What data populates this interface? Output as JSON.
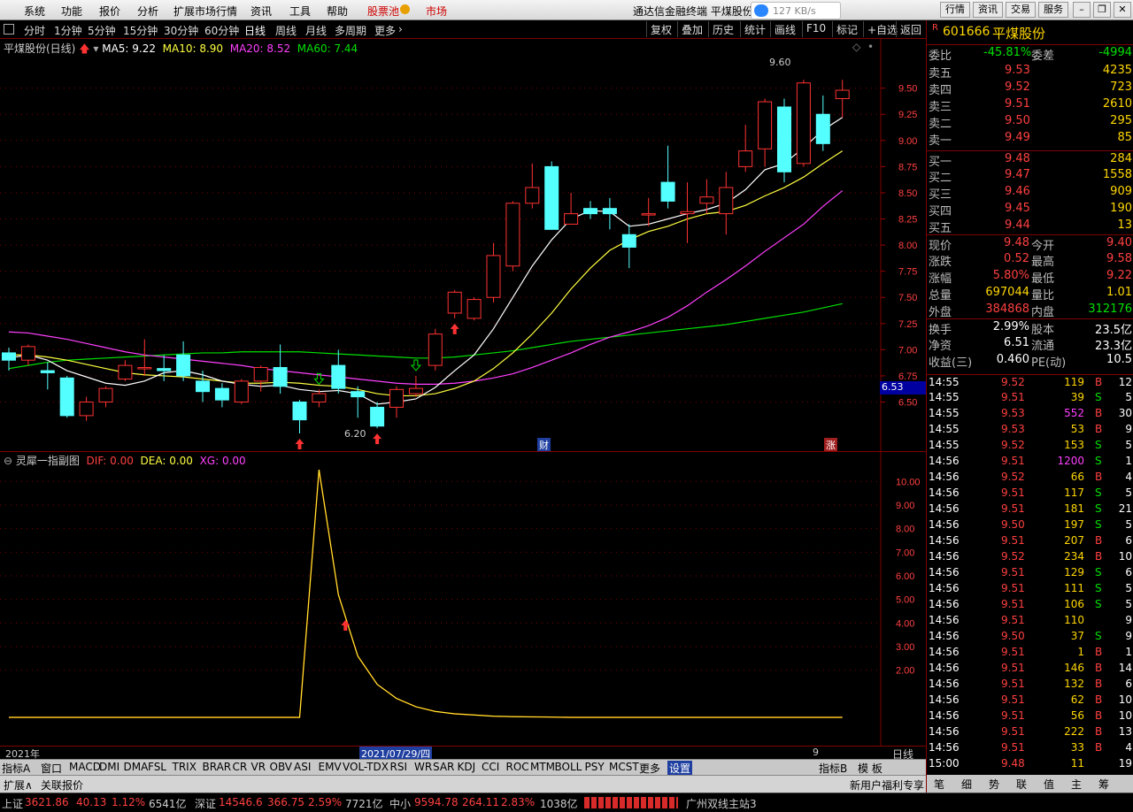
{
  "menu": {
    "items": [
      "系统",
      "功能",
      "报价",
      "分析",
      "扩展市场行情",
      "资讯",
      "工具",
      "帮助"
    ],
    "pool": "股票池",
    "market": "市场",
    "app_title": "通达信金融终端  平煤股份",
    "net_speed": "127 KB/s",
    "right_buttons": [
      "行情",
      "资讯",
      "交易",
      "服务"
    ]
  },
  "toolbar": {
    "periods": [
      "分时",
      "1分钟",
      "5分钟",
      "15分钟",
      "30分钟",
      "60分钟",
      "日线",
      "周线",
      "月线",
      "多周期",
      "更多"
    ],
    "active_period": "日线",
    "actions": [
      "复权",
      "叠加",
      "历史",
      "统计",
      "画线",
      "F10",
      "标记",
      "+自选",
      "返回"
    ]
  },
  "kline": {
    "stock_label": "平煤股份(日线)",
    "ma5": "MA5: 9.22",
    "ma10": "MA10: 8.90",
    "ma20": "MA20: 8.52",
    "ma60": "MA60: 7.44",
    "yaxis": [
      "9.50",
      "9.25",
      "9.00",
      "8.75",
      "8.50",
      "8.25",
      "8.00",
      "7.75",
      "7.50",
      "7.25",
      "7.00",
      "6.75",
      "6.50"
    ],
    "current_price_tag": "6.53",
    "high_label": "9.60",
    "low_label": "6.20",
    "marker_cai": "财",
    "marker_zhang": "涨",
    "colors": {
      "up": "#ff3232",
      "down": "#54ffff",
      "ma5": "#ffffff",
      "ma10": "#ffff40",
      "ma20": "#ff40ff",
      "ma60": "#00e000"
    }
  },
  "chart_data": {
    "type": "candlestick",
    "ylim": [
      6.2,
      9.7
    ],
    "candles": [
      {
        "o": 6.97,
        "c": 6.9,
        "h": 7.02,
        "l": 6.8
      },
      {
        "o": 6.9,
        "c": 7.03,
        "h": 7.05,
        "l": 6.85
      },
      {
        "o": 6.8,
        "c": 6.78,
        "h": 6.88,
        "l": 6.62
      },
      {
        "o": 6.73,
        "c": 6.37,
        "h": 6.75,
        "l": 6.35
      },
      {
        "o": 6.37,
        "c": 6.5,
        "h": 6.55,
        "l": 6.32
      },
      {
        "o": 6.5,
        "c": 6.63,
        "h": 6.65,
        "l": 6.45
      },
      {
        "o": 6.72,
        "c": 6.85,
        "h": 6.9,
        "l": 6.7
      },
      {
        "o": 6.83,
        "c": 6.83,
        "h": 7.1,
        "l": 6.75
      },
      {
        "o": 6.82,
        "c": 6.8,
        "h": 6.95,
        "l": 6.7
      },
      {
        "o": 6.95,
        "c": 6.75,
        "h": 7.08,
        "l": 6.7
      },
      {
        "o": 6.7,
        "c": 6.6,
        "h": 6.8,
        "l": 6.5
      },
      {
        "o": 6.63,
        "c": 6.52,
        "h": 6.68,
        "l": 6.45
      },
      {
        "o": 6.5,
        "c": 6.7,
        "h": 6.72,
        "l": 6.48
      },
      {
        "o": 6.7,
        "c": 6.83,
        "h": 6.85,
        "l": 6.6
      },
      {
        "o": 6.83,
        "c": 6.65,
        "h": 7.05,
        "l": 6.58
      },
      {
        "o": 6.5,
        "c": 6.33,
        "h": 6.52,
        "l": 6.2
      },
      {
        "o": 6.5,
        "c": 6.58,
        "h": 6.62,
        "l": 6.45
      },
      {
        "o": 6.85,
        "c": 6.63,
        "h": 7.0,
        "l": 6.58
      },
      {
        "o": 6.6,
        "c": 6.55,
        "h": 6.65,
        "l": 6.35
      },
      {
        "o": 6.45,
        "c": 6.27,
        "h": 6.5,
        "l": 6.25
      },
      {
        "o": 6.45,
        "c": 6.62,
        "h": 6.65,
        "l": 6.35
      },
      {
        "o": 6.58,
        "c": 6.63,
        "h": 6.75,
        "l": 6.55
      },
      {
        "o": 6.85,
        "c": 7.15,
        "h": 7.2,
        "l": 6.8
      },
      {
        "o": 7.35,
        "c": 7.55,
        "h": 7.57,
        "l": 7.3
      },
      {
        "o": 7.3,
        "c": 7.48,
        "h": 7.5,
        "l": 7.28
      },
      {
        "o": 7.5,
        "c": 7.9,
        "h": 8.02,
        "l": 7.45
      },
      {
        "o": 7.8,
        "c": 8.4,
        "h": 8.42,
        "l": 7.75
      },
      {
        "o": 8.4,
        "c": 8.55,
        "h": 8.78,
        "l": 8.35
      },
      {
        "o": 8.75,
        "c": 8.15,
        "h": 8.8,
        "l": 8.15
      },
      {
        "o": 8.2,
        "c": 8.3,
        "h": 8.5,
        "l": 8.2
      },
      {
        "o": 8.35,
        "c": 8.3,
        "h": 8.42,
        "l": 8.25
      },
      {
        "o": 8.35,
        "c": 8.3,
        "h": 8.45,
        "l": 8.15
      },
      {
        "o": 8.1,
        "c": 7.98,
        "h": 8.2,
        "l": 7.78
      },
      {
        "o": 8.3,
        "c": 8.3,
        "h": 8.45,
        "l": 8.18
      },
      {
        "o": 8.6,
        "c": 8.42,
        "h": 8.95,
        "l": 8.35
      },
      {
        "o": 8.3,
        "c": 8.32,
        "h": 8.6,
        "l": 8.02
      },
      {
        "o": 8.4,
        "c": 8.46,
        "h": 8.63,
        "l": 8.3
      },
      {
        "o": 8.3,
        "c": 8.55,
        "h": 8.7,
        "l": 8.1
      },
      {
        "o": 8.75,
        "c": 8.9,
        "h": 9.15,
        "l": 8.7
      },
      {
        "o": 8.92,
        "c": 9.37,
        "h": 9.4,
        "l": 8.75
      },
      {
        "o": 9.32,
        "c": 8.7,
        "h": 9.4,
        "l": 8.6
      },
      {
        "o": 8.78,
        "c": 9.55,
        "h": 9.58,
        "l": 8.75
      },
      {
        "o": 9.25,
        "c": 8.97,
        "h": 9.43,
        "l": 8.9
      },
      {
        "o": 9.4,
        "c": 9.48,
        "h": 9.58,
        "l": 9.22
      }
    ],
    "ma5": [
      6.92,
      6.95,
      6.9,
      6.8,
      6.74,
      6.68,
      6.66,
      6.7,
      6.78,
      6.8,
      6.76,
      6.7,
      6.67,
      6.65,
      6.66,
      6.62,
      6.6,
      6.61,
      6.58,
      6.48,
      6.5,
      6.53,
      6.64,
      6.8,
      6.95,
      7.2,
      7.5,
      7.8,
      8.05,
      8.25,
      8.33,
      8.32,
      8.18,
      8.2,
      8.25,
      8.3,
      8.34,
      8.4,
      8.53,
      8.72,
      8.78,
      8.93,
      9.1,
      9.22
    ],
    "ma10": [
      6.95,
      6.95,
      6.93,
      6.9,
      6.86,
      6.82,
      6.78,
      6.76,
      6.75,
      6.74,
      6.72,
      6.7,
      6.68,
      6.68,
      6.69,
      6.68,
      6.66,
      6.65,
      6.62,
      6.58,
      6.56,
      6.56,
      6.58,
      6.63,
      6.7,
      6.82,
      6.97,
      7.15,
      7.35,
      7.58,
      7.78,
      7.95,
      8.05,
      8.13,
      8.18,
      8.25,
      8.3,
      8.32,
      8.38,
      8.47,
      8.55,
      8.65,
      8.78,
      8.9
    ],
    "ma20": [
      7.17,
      7.16,
      7.13,
      7.1,
      7.06,
      7.02,
      6.98,
      6.95,
      6.93,
      6.91,
      6.89,
      6.87,
      6.85,
      6.82,
      6.8,
      6.78,
      6.76,
      6.74,
      6.72,
      6.7,
      6.68,
      6.67,
      6.67,
      6.68,
      6.7,
      6.73,
      6.77,
      6.83,
      6.9,
      6.97,
      7.05,
      7.12,
      7.17,
      7.23,
      7.31,
      7.42,
      7.55,
      7.67,
      7.8,
      7.94,
      8.07,
      8.2,
      8.37,
      8.52
    ],
    "ma60": [
      6.82,
      6.85,
      6.88,
      6.9,
      6.91,
      6.92,
      6.93,
      6.94,
      6.95,
      6.96,
      6.97,
      6.97,
      6.98,
      6.98,
      6.98,
      6.98,
      6.97,
      6.96,
      6.95,
      6.94,
      6.93,
      6.92,
      6.92,
      6.93,
      6.95,
      6.97,
      6.99,
      7.02,
      7.05,
      7.08,
      7.1,
      7.12,
      7.14,
      7.16,
      7.18,
      7.2,
      7.22,
      7.24,
      7.27,
      7.3,
      7.33,
      7.36,
      7.4,
      7.44
    ]
  },
  "sub": {
    "title": "灵犀一指副图",
    "dif": "DIF: 0.00",
    "dea": "DEA: 0.00",
    "xg": "XG: 0.00",
    "yaxis": [
      "10.00",
      "9.00",
      "8.00",
      "7.00",
      "6.00",
      "5.00",
      "4.00",
      "3.00",
      "2.00"
    ],
    "line": [
      0,
      0,
      0,
      0,
      0,
      0,
      0,
      0,
      0,
      0,
      0,
      0,
      0,
      0,
      0,
      0,
      10.5,
      5.2,
      2.6,
      1.4,
      0.8,
      0.45,
      0.25,
      0.15,
      0.1,
      0.05,
      0.03,
      0.02,
      0.01,
      0,
      0,
      0,
      0,
      0,
      0,
      0,
      0,
      0,
      0,
      0,
      0,
      0,
      0,
      0
    ]
  },
  "dates": {
    "year": "2021年",
    "cursor": "2021/07/29/四",
    "month": "9",
    "period": "日线"
  },
  "tabs": [
    "指标A",
    "窗口",
    "MACD",
    "DMI",
    "DMA",
    "FSL",
    "TRIX",
    "BRAR",
    "CR",
    "VR",
    "OBV",
    "ASI",
    "EMV",
    "VOL-TDX",
    "RSI",
    "WR",
    "SAR",
    "KDJ",
    "CCI",
    "ROC",
    "MTM",
    "BOLL",
    "PSY",
    "MCST",
    "更多",
    "设置",
    "指标B",
    "模 板"
  ],
  "ext": {
    "left": "扩展∧",
    "link": "关联报价",
    "promo": "新用户福利专享"
  },
  "quote": {
    "code": "601666",
    "name": "平煤股份",
    "weibi": {
      "label": "委比",
      "value": "-45.81%",
      "label2": "委差",
      "value2": "-4994"
    },
    "asks": [
      {
        "label": "卖五",
        "price": "9.53",
        "vol": "4235"
      },
      {
        "label": "卖四",
        "price": "9.52",
        "vol": "723"
      },
      {
        "label": "卖三",
        "price": "9.51",
        "vol": "2610"
      },
      {
        "label": "卖二",
        "price": "9.50",
        "vol": "295"
      },
      {
        "label": "卖一",
        "price": "9.49",
        "vol": "85"
      }
    ],
    "bids": [
      {
        "label": "买一",
        "price": "9.48",
        "vol": "284"
      },
      {
        "label": "买二",
        "price": "9.47",
        "vol": "1558"
      },
      {
        "label": "买三",
        "price": "9.46",
        "vol": "909"
      },
      {
        "label": "买四",
        "price": "9.45",
        "vol": "190"
      },
      {
        "label": "买五",
        "price": "9.44",
        "vol": "13"
      }
    ],
    "stats": [
      {
        "l1": "现价",
        "v1": "9.48",
        "l2": "今开",
        "v2": "9.40"
      },
      {
        "l1": "涨跌",
        "v1": "0.52",
        "l2": "最高",
        "v2": "9.58"
      },
      {
        "l1": "涨幅",
        "v1": "5.80%",
        "l2": "最低",
        "v2": "9.22"
      },
      {
        "l1": "总量",
        "v1": "697044",
        "l2": "量比",
        "v2": "1.01"
      },
      {
        "l1": "外盘",
        "v1": "384868",
        "l2": "内盘",
        "v2": "312176"
      },
      {
        "l1": "换手",
        "v1": "2.99%",
        "l2": "股本",
        "v2": "23.5亿"
      },
      {
        "l1": "净资",
        "v1": "6.51",
        "l2": "流通",
        "v2": "23.3亿"
      },
      {
        "l1": "收益(三)",
        "v1": "0.460",
        "l2": "PE(动)",
        "v2": "10.5"
      }
    ],
    "ticks": [
      {
        "t": "14:55",
        "p": "9.52",
        "v": "119",
        "bs": "B",
        "n": "12"
      },
      {
        "t": "14:55",
        "p": "9.51",
        "v": "39",
        "bs": "S",
        "n": "5"
      },
      {
        "t": "14:55",
        "p": "9.53",
        "v": "552",
        "bs": "B",
        "n": "30"
      },
      {
        "t": "14:55",
        "p": "9.53",
        "v": "53",
        "bs": "B",
        "n": "9"
      },
      {
        "t": "14:55",
        "p": "9.52",
        "v": "153",
        "bs": "S",
        "n": "5"
      },
      {
        "t": "14:56",
        "p": "9.51",
        "v": "1200",
        "bs": "S",
        "n": "1"
      },
      {
        "t": "14:56",
        "p": "9.52",
        "v": "66",
        "bs": "B",
        "n": "4"
      },
      {
        "t": "14:56",
        "p": "9.51",
        "v": "117",
        "bs": "S",
        "n": "5"
      },
      {
        "t": "14:56",
        "p": "9.51",
        "v": "181",
        "bs": "S",
        "n": "21"
      },
      {
        "t": "14:56",
        "p": "9.50",
        "v": "197",
        "bs": "S",
        "n": "5"
      },
      {
        "t": "14:56",
        "p": "9.51",
        "v": "207",
        "bs": "B",
        "n": "6"
      },
      {
        "t": "14:56",
        "p": "9.52",
        "v": "234",
        "bs": "B",
        "n": "10"
      },
      {
        "t": "14:56",
        "p": "9.51",
        "v": "129",
        "bs": "S",
        "n": "6"
      },
      {
        "t": "14:56",
        "p": "9.51",
        "v": "111",
        "bs": "S",
        "n": "5"
      },
      {
        "t": "14:56",
        "p": "9.51",
        "v": "106",
        "bs": "S",
        "n": "5"
      },
      {
        "t": "14:56",
        "p": "9.51",
        "v": "110",
        "bs": "",
        "n": "9"
      },
      {
        "t": "14:56",
        "p": "9.50",
        "v": "37",
        "bs": "S",
        "n": "9"
      },
      {
        "t": "14:56",
        "p": "9.51",
        "v": "1",
        "bs": "B",
        "n": "1"
      },
      {
        "t": "14:56",
        "p": "9.51",
        "v": "146",
        "bs": "B",
        "n": "14"
      },
      {
        "t": "14:56",
        "p": "9.51",
        "v": "132",
        "bs": "B",
        "n": "6"
      },
      {
        "t": "14:56",
        "p": "9.51",
        "v": "62",
        "bs": "B",
        "n": "10"
      },
      {
        "t": "14:56",
        "p": "9.51",
        "v": "56",
        "bs": "B",
        "n": "10"
      },
      {
        "t": "14:56",
        "p": "9.51",
        "v": "222",
        "bs": "B",
        "n": "13"
      },
      {
        "t": "14:56",
        "p": "9.51",
        "v": "33",
        "bs": "B",
        "n": "4"
      },
      {
        "t": "15:00",
        "p": "9.48",
        "v": "11",
        "bs": "",
        "n": "19"
      }
    ],
    "bottom_tabs": [
      "笔",
      "细",
      "势",
      "联",
      "值",
      "主",
      "筹"
    ]
  },
  "status": {
    "sh_label": "上证",
    "sh_val": "3621.86",
    "sh_chg": "40.13",
    "sh_pct": "1.12%",
    "sh_amt": "6541亿",
    "sz_label": "深证",
    "sz_val": "14546.6",
    "sz_chg": "366.75",
    "sz_pct": "2.59%",
    "sz_amt": "7721亿",
    "zx_label": "中小",
    "zx_val": "9594.78",
    "zx_chg": "264.11",
    "zx_pct": "2.83%",
    "zx_amt": "1038亿",
    "server": "广州双线主站3"
  }
}
